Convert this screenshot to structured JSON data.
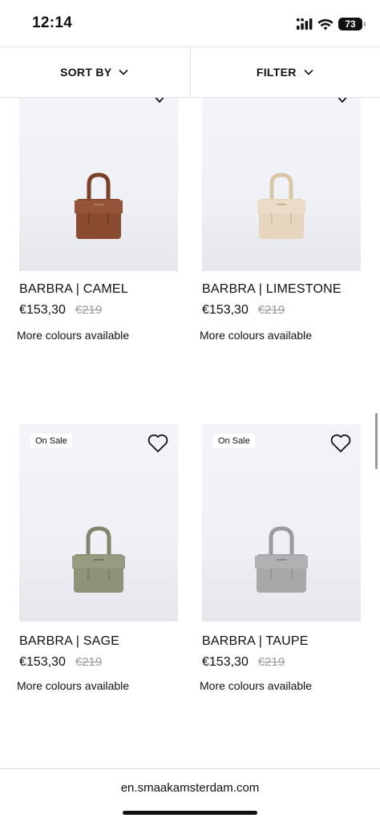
{
  "status_bar": {
    "time": "12:14",
    "battery": "73",
    "icons": [
      "cellular-signal-icon",
      "wifi-icon",
      "battery-icon"
    ]
  },
  "toolbar": {
    "sort_label": "SORT BY",
    "filter_label": "FILTER"
  },
  "products": [
    {
      "name": "BARBRA | CAMEL",
      "price": "€153,30",
      "old_price": "€219",
      "colours_note": "More colours available",
      "badge": "",
      "bag_color": "#8a4b30"
    },
    {
      "name": "BARBRA | LIMESTONE",
      "price": "€153,30",
      "old_price": "€219",
      "colours_note": "More colours available",
      "badge": "",
      "bag_color": "#e6d6bf"
    },
    {
      "name": "BARBRA | SAGE",
      "price": "€153,30",
      "old_price": "€219",
      "colours_note": "More colours available",
      "badge": "On Sale",
      "bag_color": "#8c9378"
    },
    {
      "name": "BARBRA | TAUPE",
      "price": "€153,30",
      "old_price": "€219",
      "colours_note": "More colours available",
      "badge": "On Sale",
      "bag_color": "#a8a7aa"
    }
  ],
  "url_bar": {
    "url": "en.smaakamsterdam.com"
  }
}
